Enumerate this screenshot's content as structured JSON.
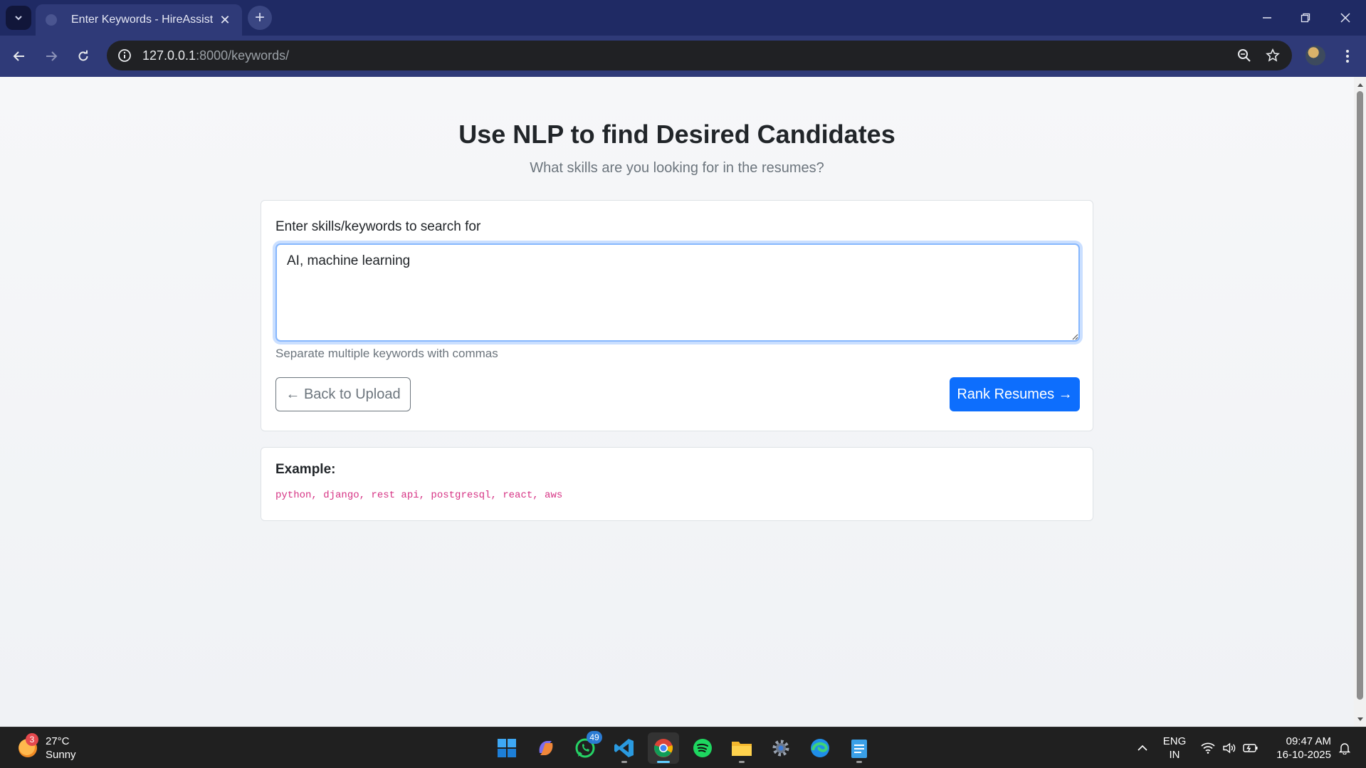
{
  "browser": {
    "tab_title": "Enter Keywords - HireAssist",
    "url_host": "127.0.0.1",
    "url_path": ":8000/keywords/"
  },
  "page": {
    "title": "Use NLP to find Desired Candidates",
    "subtitle": "What skills are you looking for in the resumes?",
    "form": {
      "label": "Enter skills/keywords to search for",
      "keywords_value": "AI, machine learning",
      "help_text": "Separate multiple keywords with commas",
      "back_button": "← Back to Upload",
      "rank_button": "Rank Resumes →"
    },
    "example": {
      "heading": "Example:",
      "code": "python, django, rest api, postgresql, react, aws"
    }
  },
  "taskbar": {
    "weather_temp": "27°C",
    "weather_desc": "Sunny",
    "weather_badge": "3",
    "whatsapp_badge": "49",
    "lang_line1": "ENG",
    "lang_line2": "IN",
    "time": "09:47 AM",
    "date": "16-10-2025"
  },
  "colors": {
    "titlebar": "#1f2a64",
    "toolbar": "#2f3a78",
    "primary": "#0d6efd",
    "code": "#d63384"
  }
}
